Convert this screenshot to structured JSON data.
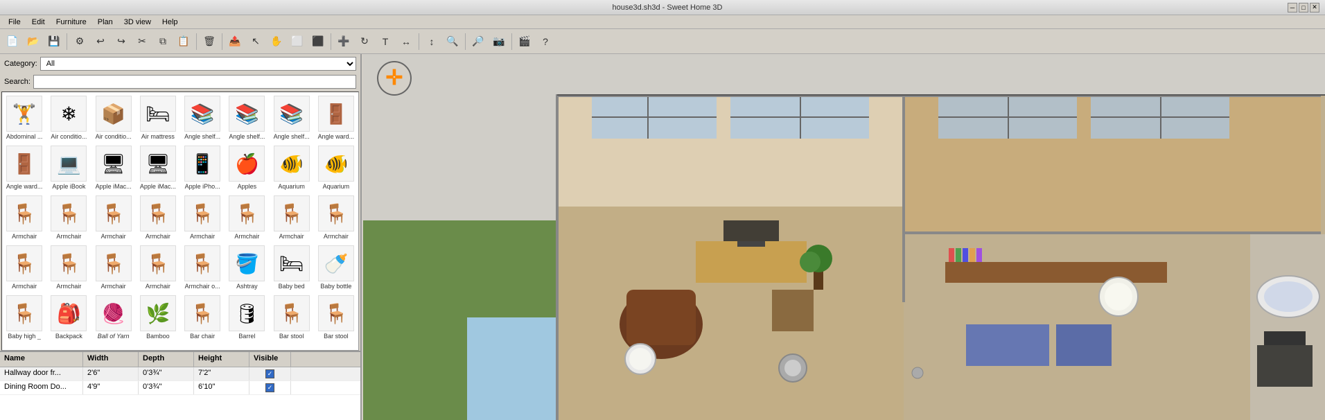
{
  "titlebar": {
    "title": "house3d.sh3d - Sweet Home 3D",
    "minimize": "─",
    "maximize": "□",
    "close": "✕"
  },
  "menu": {
    "items": [
      "File",
      "Edit",
      "Furniture",
      "Plan",
      "3D view",
      "Help"
    ]
  },
  "toolbar": {
    "buttons": [
      {
        "name": "new",
        "icon": "📄"
      },
      {
        "name": "open",
        "icon": "📂"
      },
      {
        "name": "save",
        "icon": "💾"
      },
      {
        "name": "preferences",
        "icon": "⚙"
      },
      {
        "name": "undo",
        "icon": "↩"
      },
      {
        "name": "redo",
        "icon": "↪"
      },
      {
        "name": "cut",
        "icon": "✂"
      },
      {
        "name": "copy",
        "icon": "⧉"
      },
      {
        "name": "paste",
        "icon": "📋"
      },
      {
        "name": "delete",
        "icon": "🗑"
      },
      {
        "name": "export",
        "icon": "📤"
      },
      {
        "name": "select",
        "icon": "↖"
      },
      {
        "name": "pan",
        "icon": "✋"
      },
      {
        "name": "create-walls",
        "icon": "⬜"
      },
      {
        "name": "create-rooms",
        "icon": "⬛"
      },
      {
        "name": "add-furniture",
        "icon": "➕"
      },
      {
        "name": "rotate",
        "icon": "↻"
      },
      {
        "name": "label",
        "icon": "T"
      },
      {
        "name": "dim1",
        "icon": "↔"
      },
      {
        "name": "dim2",
        "icon": "↕"
      },
      {
        "name": "zoom-in",
        "icon": "🔍"
      },
      {
        "name": "zoom-out",
        "icon": "🔎"
      },
      {
        "name": "photo",
        "icon": "📷"
      },
      {
        "name": "video",
        "icon": "🎬"
      },
      {
        "name": "help",
        "icon": "?"
      }
    ]
  },
  "sidebar": {
    "category_label": "Category:",
    "category_value": "All",
    "search_label": "Search:",
    "search_value": ""
  },
  "furniture": [
    {
      "id": 1,
      "name": "Abdominal ...",
      "icon": "🏋"
    },
    {
      "id": 2,
      "name": "Air conditio...",
      "icon": "❄"
    },
    {
      "id": 3,
      "name": "Air conditio...",
      "icon": "📦"
    },
    {
      "id": 4,
      "name": "Air mattress",
      "icon": "🛏"
    },
    {
      "id": 5,
      "name": "Angle shelf...",
      "icon": "📚"
    },
    {
      "id": 6,
      "name": "Angle shelf...",
      "icon": "📚"
    },
    {
      "id": 7,
      "name": "Angle shelf...",
      "icon": "📚"
    },
    {
      "id": 8,
      "name": "Angle ward...",
      "icon": "🚪"
    },
    {
      "id": 9,
      "name": "Angle ward...",
      "icon": "🚪"
    },
    {
      "id": 10,
      "name": "Apple iBook",
      "icon": "💻"
    },
    {
      "id": 11,
      "name": "Apple iMac...",
      "icon": "🖥"
    },
    {
      "id": 12,
      "name": "Apple iMac...",
      "icon": "🖥"
    },
    {
      "id": 13,
      "name": "Apple iPho...",
      "icon": "📱"
    },
    {
      "id": 14,
      "name": "Apples",
      "icon": "🍎"
    },
    {
      "id": 15,
      "name": "Aquarium",
      "icon": "🐠"
    },
    {
      "id": 16,
      "name": "Aquarium",
      "icon": "🐠"
    },
    {
      "id": 17,
      "name": "Armchair",
      "icon": "🪑"
    },
    {
      "id": 18,
      "name": "Armchair",
      "icon": "🪑"
    },
    {
      "id": 19,
      "name": "Armchair",
      "icon": "🪑"
    },
    {
      "id": 20,
      "name": "Armchair",
      "icon": "🪑"
    },
    {
      "id": 21,
      "name": "Armchair",
      "icon": "🪑"
    },
    {
      "id": 22,
      "name": "Armchair",
      "icon": "🪑"
    },
    {
      "id": 23,
      "name": "Armchair",
      "icon": "🪑"
    },
    {
      "id": 24,
      "name": "Armchair",
      "icon": "🪑"
    },
    {
      "id": 25,
      "name": "Armchair",
      "icon": "🪑"
    },
    {
      "id": 26,
      "name": "Armchair",
      "icon": "🪑"
    },
    {
      "id": 27,
      "name": "Armchair",
      "icon": "🪑"
    },
    {
      "id": 28,
      "name": "Armchair",
      "icon": "🪑"
    },
    {
      "id": 29,
      "name": "Armchair o...",
      "icon": "🪑"
    },
    {
      "id": 30,
      "name": "Ashtray",
      "icon": "🪣"
    },
    {
      "id": 31,
      "name": "Baby bed",
      "icon": "🛏"
    },
    {
      "id": 32,
      "name": "Baby bottle",
      "icon": "🍼"
    },
    {
      "id": 33,
      "name": "Baby high _",
      "icon": "🪑"
    },
    {
      "id": 34,
      "name": "Backpack",
      "icon": "🎒"
    },
    {
      "id": 35,
      "name": "Ball of Yarn",
      "icon": "🧶",
      "italic": true
    },
    {
      "id": 36,
      "name": "Bamboo",
      "icon": "🌿"
    },
    {
      "id": 37,
      "name": "Bar chair",
      "icon": "🪑"
    },
    {
      "id": 38,
      "name": "Barrel",
      "icon": "🛢"
    },
    {
      "id": 39,
      "name": "Bar stool",
      "icon": "🪑"
    },
    {
      "id": 40,
      "name": "Bar stool",
      "icon": "🪑"
    }
  ],
  "table": {
    "headers": [
      "Name",
      "Width",
      "Depth",
      "Height",
      "Visible"
    ],
    "rows": [
      {
        "name": "Hallway door fr...",
        "width": "2'6\"",
        "depth": "0'3¾\"",
        "height": "7'2\"",
        "visible": true
      },
      {
        "name": "Dining Room Do...",
        "width": "4'9\"",
        "depth": "0'3¾\"",
        "height": "6'10\"",
        "visible": true
      }
    ]
  },
  "compass": {
    "symbol": "✛",
    "color": "#ff6600"
  },
  "colors": {
    "bg": "#d4d0c8",
    "panel_bg": "#d4d0c8",
    "white": "#ffffff",
    "accent": "#316ac5",
    "border": "#888888"
  }
}
